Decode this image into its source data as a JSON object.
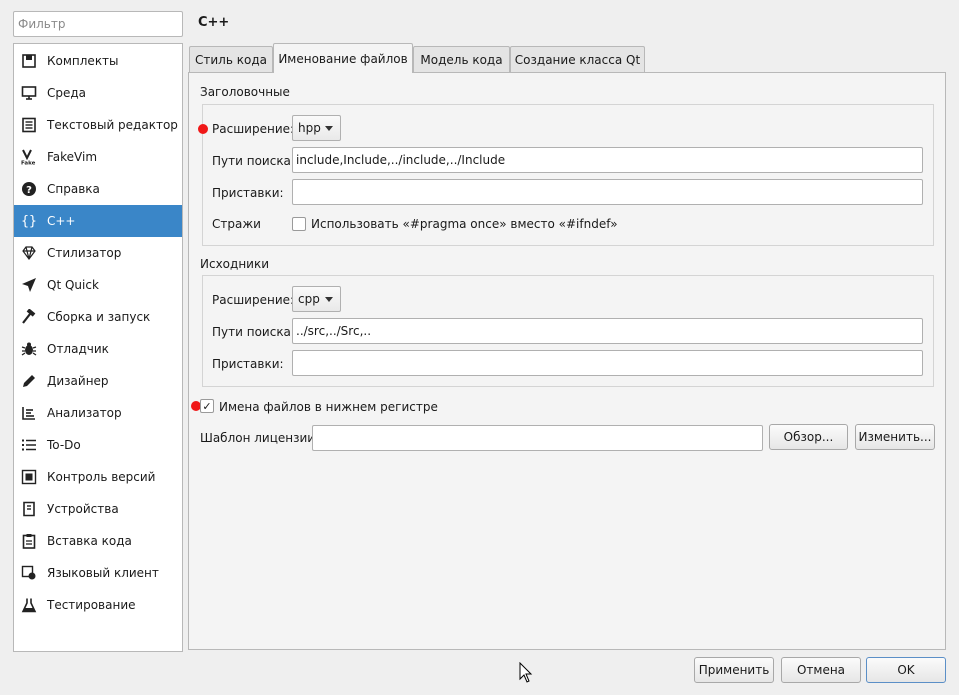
{
  "filter": {
    "placeholder": "Фильтр"
  },
  "sidebar": {
    "items": [
      {
        "label": "Комплекты",
        "icon": "kits-icon"
      },
      {
        "label": "Среда",
        "icon": "monitor-icon"
      },
      {
        "label": "Текстовый редактор",
        "icon": "text-editor-icon"
      },
      {
        "label": "FakeVim",
        "icon": "fakevim-icon"
      },
      {
        "label": "Справка",
        "icon": "help-icon"
      },
      {
        "label": "C++",
        "icon": "braces-icon",
        "selected": true
      },
      {
        "label": "Стилизатор",
        "icon": "diamond-icon"
      },
      {
        "label": "Qt Quick",
        "icon": "qt-quick-icon"
      },
      {
        "label": "Сборка и запуск",
        "icon": "hammer-icon"
      },
      {
        "label": "Отладчик",
        "icon": "bug-icon"
      },
      {
        "label": "Дизайнер",
        "icon": "pencil-icon"
      },
      {
        "label": "Анализатор",
        "icon": "analyzer-icon"
      },
      {
        "label": "To-Do",
        "icon": "todo-list-icon"
      },
      {
        "label": "Контроль версий",
        "icon": "version-control-icon"
      },
      {
        "label": "Устройства",
        "icon": "devices-icon"
      },
      {
        "label": "Вставка кода",
        "icon": "paste-icon"
      },
      {
        "label": "Языковый клиент",
        "icon": "language-client-icon"
      },
      {
        "label": "Тестирование",
        "icon": "flask-icon"
      }
    ]
  },
  "page_title": "C++",
  "tabs": [
    {
      "label": "Стиль кода"
    },
    {
      "label": "Именование файлов",
      "active": true
    },
    {
      "label": "Модель кода"
    },
    {
      "label": "Создание класса Qt"
    }
  ],
  "headers": {
    "title": "Заголовочные",
    "ext_label": "Расширение:",
    "ext_value": "hpp",
    "search_label": "Пути поиска:",
    "search_value": "include,Include,../include,../Include",
    "prefix_label": "Приставки:",
    "prefix_value": "",
    "guards_label": "Стражи",
    "pragma_label": "Использовать «#pragma once» вместо «#ifndef»",
    "pragma_checked": false
  },
  "sources": {
    "title": "Исходники",
    "ext_label": "Расширение:",
    "ext_value": "cpp",
    "search_label": "Пути поиска:",
    "search_value": "../src,../Src,..",
    "prefix_label": "Приставки:",
    "prefix_value": ""
  },
  "lowercase": {
    "label": "Имена файлов в нижнем регистре",
    "checked": true,
    "mark": "✓"
  },
  "license": {
    "label": "Шаблон лицензии:",
    "value": "",
    "browse": "Обзор...",
    "edit": "Изменить..."
  },
  "footer": {
    "apply": "Применить",
    "cancel": "Отмена",
    "ok": "OK"
  },
  "colors": {
    "accent": "#3a86c8",
    "marker": "#f01818"
  }
}
